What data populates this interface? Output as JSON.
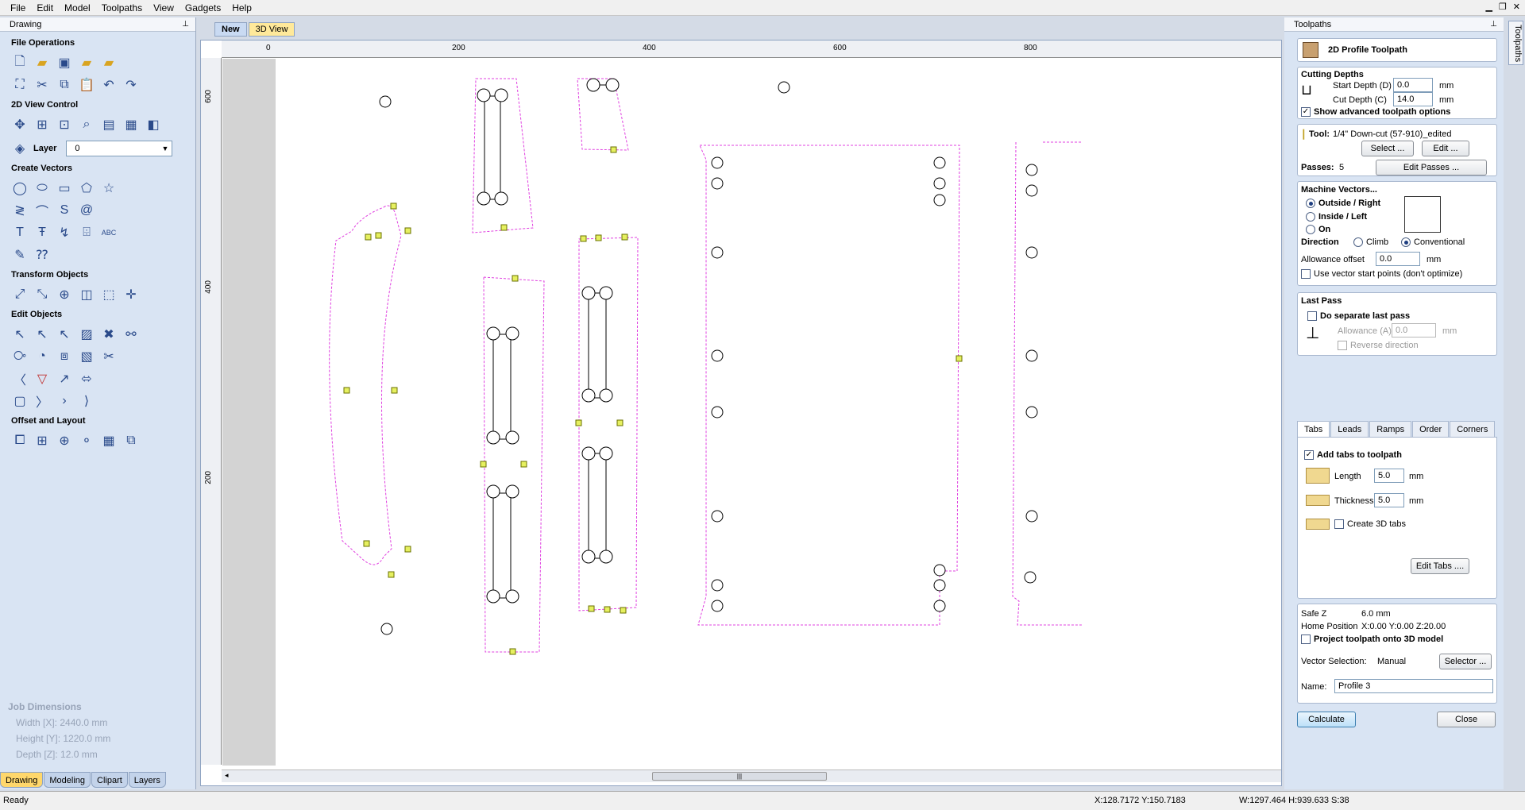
{
  "menu": [
    "File",
    "Edit",
    "Model",
    "Toolpaths",
    "View",
    "Gadgets",
    "Help"
  ],
  "left_panel": {
    "title": "Drawing",
    "sections": {
      "file_ops": "File Operations",
      "view_control": "2D View Control",
      "create_vectors": "Create Vectors",
      "transform": "Transform Objects",
      "edit": "Edit Objects",
      "offset": "Offset and Layout"
    },
    "layer_label": "Layer",
    "layer_value": "0",
    "job_dimensions": {
      "title": "Job Dimensions",
      "width": "Width  [X]: 2440.0 mm",
      "height": "Height [Y]: 1220.0 mm",
      "depth": "Depth  [Z]: 12.0 mm"
    },
    "bottom_tabs": [
      "Drawing",
      "Modeling",
      "Clipart",
      "Layers"
    ]
  },
  "doc_tabs": [
    "New",
    "3D View"
  ],
  "ruler": {
    "h_labels": [
      "0",
      "200",
      "400",
      "600",
      "800"
    ],
    "v_labels": [
      "600",
      "400",
      "200"
    ]
  },
  "right_panel": {
    "title": "Toolpaths",
    "side_tab": "Toolpaths",
    "toolpath_name": "2D Profile Toolpath",
    "cutting_depths": {
      "title": "Cutting Depths",
      "start_label": "Start Depth (D)",
      "start_value": "0.0",
      "cut_label": "Cut Depth (C)",
      "cut_value": "14.0",
      "unit": "mm",
      "advanced_label": "Show advanced toolpath options",
      "advanced_checked": true
    },
    "tool": {
      "label": "Tool:",
      "value": "1/4\"  Down-cut (57-910)_edited",
      "select_btn": "Select ...",
      "edit_btn": "Edit ...",
      "passes_label": "Passes:",
      "passes_value": "5",
      "edit_passes_btn": "Edit Passes ..."
    },
    "machine_vectors": {
      "title": "Machine Vectors...",
      "outside": "Outside / Right",
      "inside": "Inside / Left",
      "on": "On",
      "selected": "outside",
      "direction_label": "Direction",
      "climb": "Climb",
      "conventional": "Conventional",
      "direction_selected": "conventional",
      "allowance_label": "Allowance offset",
      "allowance_value": "0.0",
      "unit": "mm",
      "start_points_label": "Use vector start points (don't optimize)"
    },
    "last_pass": {
      "title": "Last Pass",
      "separate_label": "Do separate last pass",
      "allowance_label": "Allowance (A)",
      "allowance_value": "0.0",
      "unit": "mm",
      "reverse_label": "Reverse direction"
    },
    "tabs": [
      "Tabs",
      "Leads",
      "Ramps",
      "Order",
      "Corners"
    ],
    "tabs_panel": {
      "add_label": "Add tabs to toolpath",
      "add_checked": true,
      "length_label": "Length",
      "length_value": "5.0",
      "thickness_label": "Thickness",
      "thickness_value": "5.0",
      "unit": "mm",
      "create3d_label": "Create 3D tabs",
      "edit_tabs_btn": "Edit Tabs ...."
    },
    "misc": {
      "safe_z_label": "Safe Z",
      "safe_z_value": "6.0 mm",
      "home_label": "Home Position",
      "home_value": "X:0.00 Y:0.00 Z:20.00",
      "project_label": "Project toolpath onto 3D model",
      "vector_sel_label": "Vector Selection:",
      "vector_sel_value": "Manual",
      "selector_btn": "Selector ...",
      "name_label": "Name:",
      "name_value": "Profile 3"
    },
    "calculate_btn": "Calculate",
    "close_btn": "Close"
  },
  "status": {
    "left": "Ready",
    "coords": "X:128.7172 Y:150.7183",
    "dims": "W:1297.464  H:939.633  S:38"
  },
  "colors": {
    "toolpath": "#e040e0",
    "tab_marker": "#e6f060",
    "panel_bg": "#d9e4f3"
  }
}
